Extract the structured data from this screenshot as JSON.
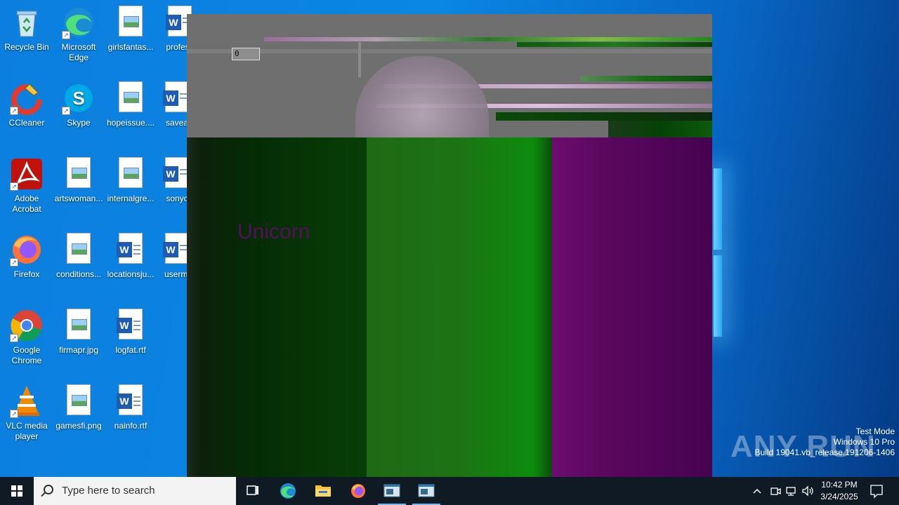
{
  "desktop": {
    "icons": [
      {
        "label": "Recycle Bin",
        "icon": "recycle-bin-icon"
      },
      {
        "label": "Microsoft Edge",
        "icon": "edge-icon"
      },
      {
        "label": "girlsfantas...",
        "icon": "image-file-icon"
      },
      {
        "label": "profess",
        "icon": "word-doc-icon"
      },
      {
        "label": "CCleaner",
        "icon": "ccleaner-icon"
      },
      {
        "label": "Skype",
        "icon": "skype-icon"
      },
      {
        "label": "hopeissue....",
        "icon": "image-file-icon"
      },
      {
        "label": "savea",
        "icon": "word-doc-icon"
      },
      {
        "label": "Adobe Acrobat",
        "icon": "acrobat-icon"
      },
      {
        "label": "artswoman...",
        "icon": "image-file-icon"
      },
      {
        "label": "internalgre...",
        "icon": "image-file-icon"
      },
      {
        "label": "sonyc",
        "icon": "word-doc-icon"
      },
      {
        "label": "Firefox",
        "icon": "firefox-icon"
      },
      {
        "label": "conditions...",
        "icon": "image-file-icon"
      },
      {
        "label": "locationsju...",
        "icon": "word-doc-icon"
      },
      {
        "label": "usermi",
        "icon": "word-doc-icon"
      },
      {
        "label": "Google Chrome",
        "icon": "chrome-icon"
      },
      {
        "label": "firmapr.jpg",
        "icon": "image-file-icon"
      },
      {
        "label": "logfat.rtf",
        "icon": "word-doc-icon"
      },
      {
        "label": "VLC media player",
        "icon": "vlc-icon"
      },
      {
        "label": "gamesfi.png",
        "icon": "image-file-icon"
      },
      {
        "label": "nainfo.rtf",
        "icon": "word-doc-icon"
      }
    ]
  },
  "app": {
    "counter_value": "0",
    "stripe_text": "Unicorn"
  },
  "watermark": {
    "brand": "ANY RUN",
    "line1": "Test Mode",
    "line2": "Windows 10 Pro",
    "line3": "Build 19041.vb_release.191206-1406"
  },
  "taskbar": {
    "search_placeholder": "Type here to search",
    "time": "10:42 PM",
    "date": "3/24/2025"
  }
}
